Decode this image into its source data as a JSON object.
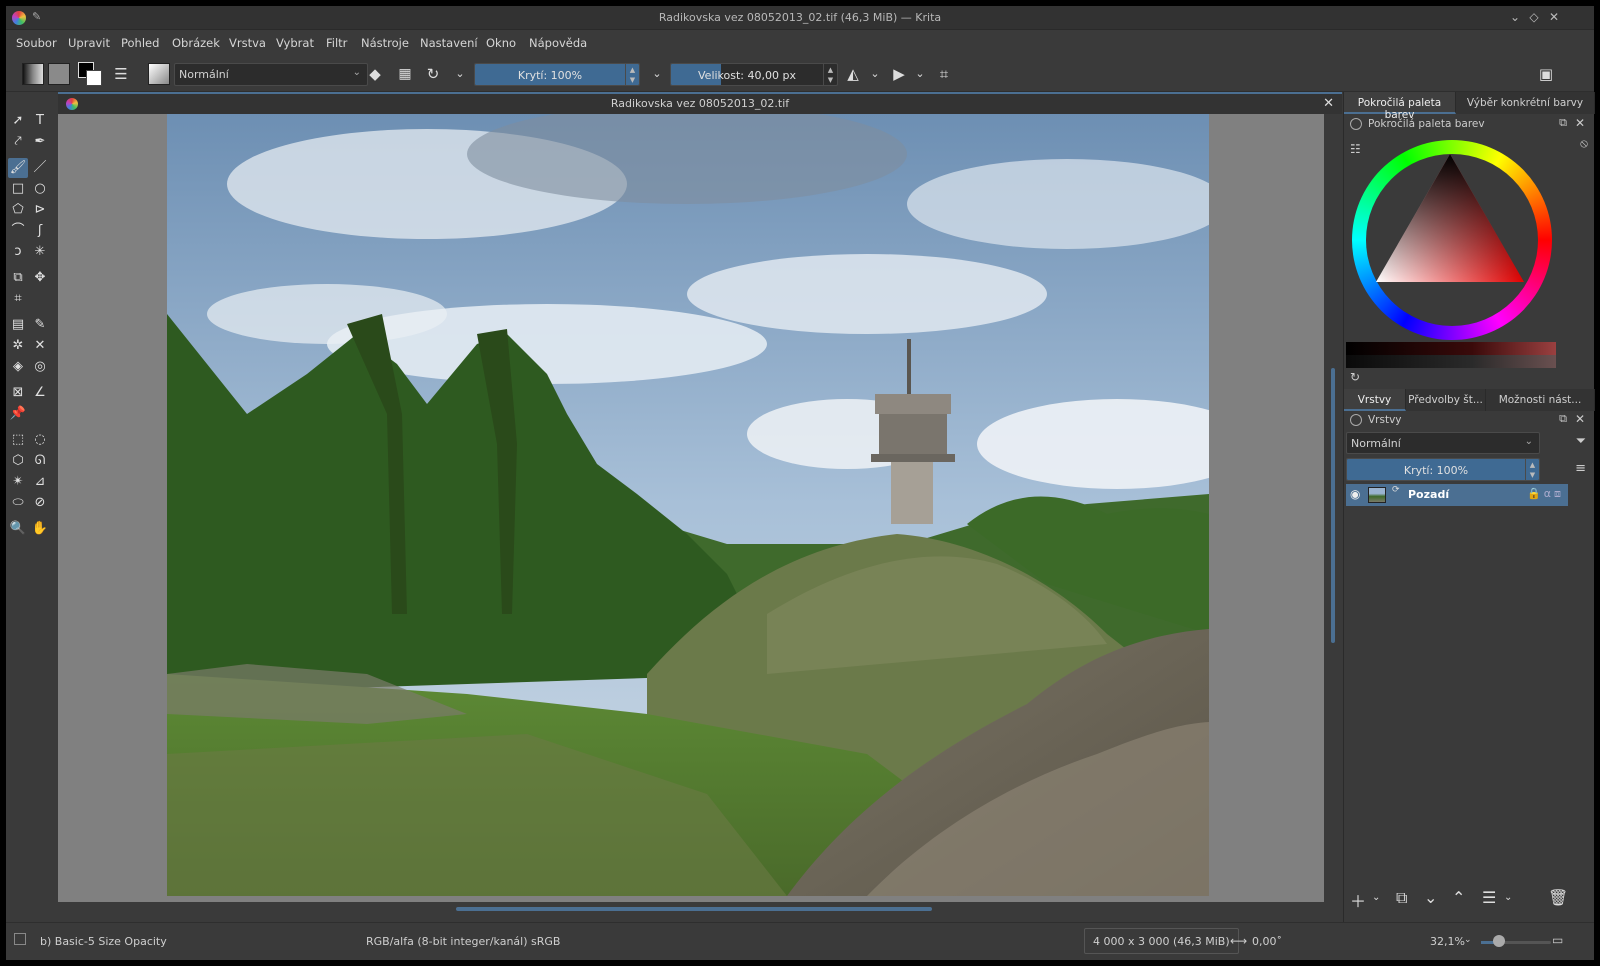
{
  "window": {
    "title": "Radikovska vez 08052013_02.tif (46,3 MiB) — Krita"
  },
  "menu": [
    "Soubor",
    "Upravit",
    "Pohled",
    "Obrázek",
    "Vrstva",
    "Vybrat",
    "Filtr",
    "Nástroje",
    "Nastavení",
    "Okno",
    "Nápověda"
  ],
  "toolbar": {
    "blend_mode": "Normální",
    "opacity_label": "Krytí: 100%",
    "opacity_fraction": 1.0,
    "size_label": "Velikost: 40,00 px",
    "size_fraction": 0.08
  },
  "document": {
    "tab_title": "Radikovska vez 08052013_02.tif"
  },
  "dock": {
    "top_tabs": [
      "Pokročilá paleta barev",
      "Výběr konkrétní barvy"
    ],
    "palette_title": "Pokročilá paleta barev",
    "layer_tabs": [
      "Vrstvy",
      "Předvolby št...",
      "Možnosti nást..."
    ],
    "layers_title": "Vrstvy",
    "layer_blend": "Normální",
    "layer_opacity_label": "Krytí:  100%",
    "layers": [
      {
        "name": "Pozadí",
        "visible": true
      }
    ]
  },
  "status": {
    "brush": "b) Basic-5 Size Opacity",
    "color_model": "RGB/alfa (8-bit integer/kanál)  sRGB",
    "dimensions": "4 000 x 3 000 (46,3 MiB)",
    "rotation": "0,00˚",
    "zoom": "32,1%"
  },
  "colors": {
    "accent": "#4b6f92",
    "panel": "#3a3a3a",
    "canvas_bg": "#808080"
  }
}
